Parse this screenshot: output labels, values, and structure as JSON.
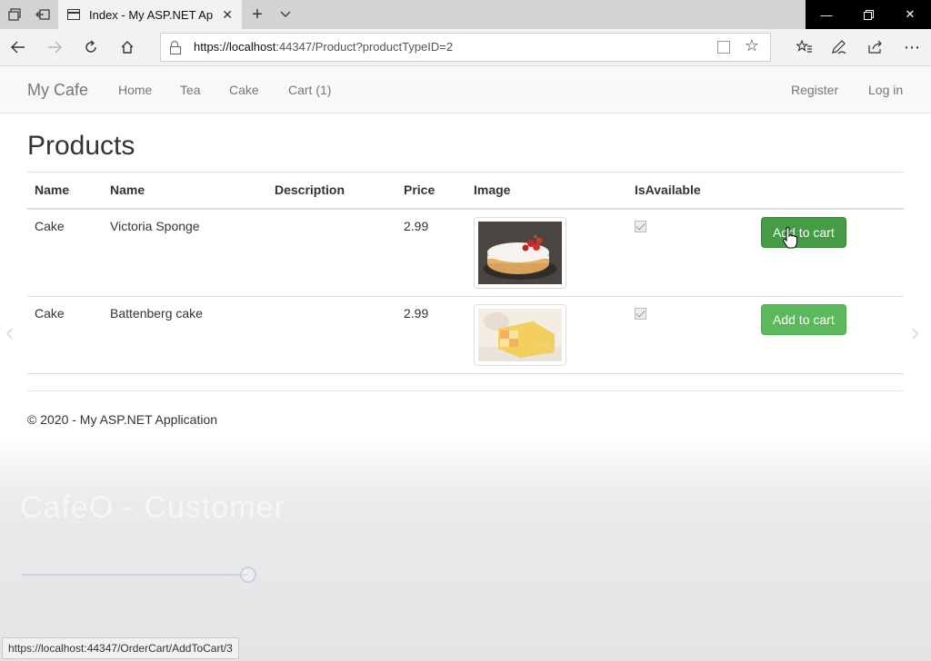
{
  "browser": {
    "tab_title": "Index - My ASP.NET App",
    "url_host": "https://localhost",
    "url_rest": ":44347/Product?productTypeID=2",
    "status_url": "https://localhost:44347/OrderCart/AddToCart/3"
  },
  "site": {
    "brand": "My Cafe",
    "nav": [
      "Home",
      "Tea",
      "Cake",
      "Cart (1)"
    ],
    "right_nav": [
      "Register",
      "Log in"
    ]
  },
  "page": {
    "title": "Products",
    "columns": [
      "Name",
      "Name",
      "Description",
      "Price",
      "Image",
      "IsAvailable"
    ],
    "rows": [
      {
        "type": "Cake",
        "name": "Victoria Sponge",
        "description": "",
        "price": "2.99",
        "available": true,
        "button": "Add to cart"
      },
      {
        "type": "Cake",
        "name": "Battenberg cake",
        "description": "",
        "price": "2.99",
        "available": true,
        "button": "Add to cart"
      }
    ],
    "footer": "© 2020 - My ASP.NET Application"
  },
  "overlay": {
    "ghost_title": "CafeO - Customer"
  },
  "colors": {
    "button": "#5cb85c",
    "button_hover": "#449d44"
  }
}
